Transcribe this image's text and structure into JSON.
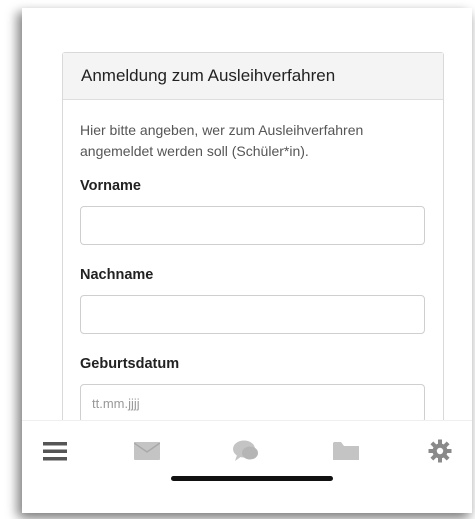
{
  "card": {
    "title": "Anmeldung zum Ausleihverfahren",
    "intro": "Hier bitte angeben, wer zum Ausleihverfahren angemeldet werden soll (Schüler*in).",
    "fields": [
      {
        "label": "Vorname",
        "value": "",
        "placeholder": ""
      },
      {
        "label": "Nachname",
        "value": "",
        "placeholder": ""
      },
      {
        "label": "Geburtsdatum",
        "value": "",
        "placeholder": "tt.mm.jjjj"
      }
    ]
  },
  "toolbar": {
    "icons": [
      "menu-icon",
      "mail-icon",
      "chat-icon",
      "folder-icon",
      "gear-icon"
    ],
    "colors": {
      "menu": "#555555",
      "inactive": "#c4c4c4",
      "gear": "#8a8a8a"
    }
  }
}
